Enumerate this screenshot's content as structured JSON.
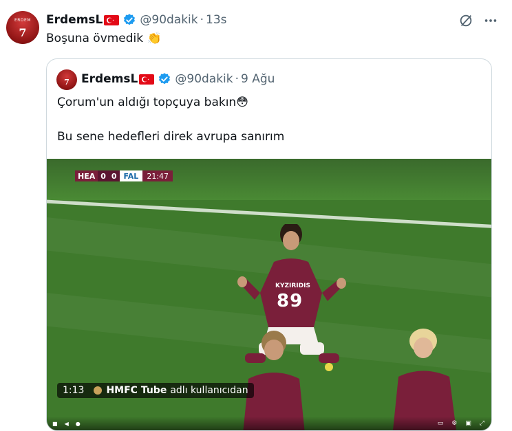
{
  "tweet": {
    "author_name": "ErdemsL",
    "handle": "@90dakik",
    "separator": "·",
    "time": "13s",
    "text": "Boşuna övmedik 👏",
    "avatar_text": "ERDEM",
    "avatar_number": "7"
  },
  "quote": {
    "author_name": "ErdemsL",
    "handle": "@90dakik",
    "separator": "·",
    "time": "9 Ağu",
    "line1": "Çorum'un aldığı topçuya bakın😳",
    "line2": "Bu sene hedefleri direk avrupa sanırım",
    "avatar_number": "7"
  },
  "video": {
    "scorebug": {
      "home": "HEA",
      "home_score": "0",
      "away_score": "0",
      "away": "FAL",
      "clock": "21:47"
    },
    "player_name": "KYZIRIDIS",
    "player_number": "89",
    "duration": "1:13",
    "source_channel": "HMFC Tube",
    "source_suffix": "adlı kullanıcıdan"
  },
  "colors": {
    "accent": "#1d9bf0",
    "muted": "#536471",
    "border": "#cfd9de",
    "maroon": "#7a1f3a",
    "pitch": "#3f7a2c"
  },
  "icons": {
    "grok": "grok-icon",
    "more": "more-icon",
    "verified": "verified-badge-icon"
  }
}
